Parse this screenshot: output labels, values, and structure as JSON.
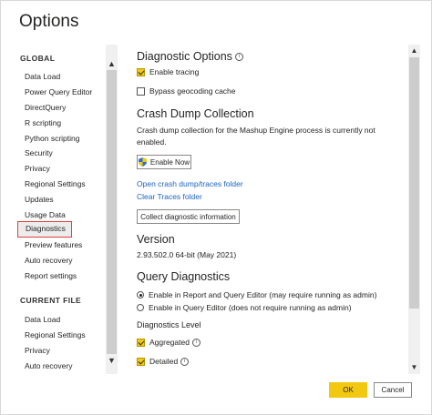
{
  "dialog": {
    "title": "Options"
  },
  "nav": {
    "global_heading": "GLOBAL",
    "global_items": [
      {
        "label": "Data Load"
      },
      {
        "label": "Power Query Editor"
      },
      {
        "label": "DirectQuery"
      },
      {
        "label": "R scripting"
      },
      {
        "label": "Python scripting"
      },
      {
        "label": "Security"
      },
      {
        "label": "Privacy"
      },
      {
        "label": "Regional Settings"
      },
      {
        "label": "Updates"
      },
      {
        "label": "Usage Data"
      },
      {
        "label": "Diagnostics",
        "selected": true
      },
      {
        "label": "Preview features"
      },
      {
        "label": "Auto recovery"
      },
      {
        "label": "Report settings"
      }
    ],
    "current_file_heading": "CURRENT FILE",
    "current_file_items": [
      {
        "label": "Data Load"
      },
      {
        "label": "Regional Settings"
      },
      {
        "label": "Privacy"
      },
      {
        "label": "Auto recovery"
      }
    ],
    "scroll_up": "▲",
    "scroll_down": "▼"
  },
  "content": {
    "diagnostic_options": {
      "title": "Diagnostic Options",
      "enable_tracing": {
        "label": "Enable tracing",
        "checked": true
      },
      "bypass_geocoding": {
        "label": "Bypass geocoding cache",
        "checked": false
      }
    },
    "crash_dump": {
      "title": "Crash Dump Collection",
      "description": "Crash dump collection for the Mashup Engine process is currently not enabled.",
      "enable_now_button": "Enable Now",
      "open_folder_link": "Open crash dump/traces folder",
      "clear_folder_link": "Clear Traces folder",
      "collect_button": "Collect diagnostic information"
    },
    "version": {
      "title": "Version",
      "value": "2.93.502.0 64-bit (May 2021)"
    },
    "query_diagnostics": {
      "title": "Query Diagnostics",
      "option_report": {
        "label": "Enable in Report and Query Editor (may require running as admin)",
        "selected": true
      },
      "option_query": {
        "label": "Enable in Query Editor (does not require running as admin)",
        "selected": false
      }
    },
    "diagnostics_level": {
      "title": "Diagnostics Level",
      "aggregated": {
        "label": "Aggregated",
        "checked": true
      },
      "detailed": {
        "label": "Detailed",
        "checked": true
      }
    },
    "info_glyph": "i"
  },
  "footer": {
    "ok": "OK",
    "cancel": "Cancel"
  },
  "colors": {
    "accent": "#f2c811",
    "link": "#1a63c4",
    "selection_border": "#e04040"
  }
}
